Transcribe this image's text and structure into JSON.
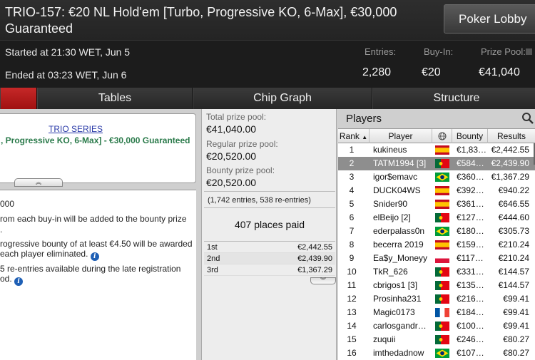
{
  "header": {
    "title": "TRIO-157: €20 NL Hold'em [Turbo, Progressive KO, 6-Max], €30,000 Guaranteed",
    "lobby_button": "Poker Lobby",
    "started": "Started at 21:30 WET, Jun 5",
    "ended": "Ended at 03:23 WET, Jun 6",
    "entries_label": "Entries:",
    "entries_value": "2,280",
    "buyin_label": "Buy-In:",
    "buyin_value": "€20",
    "prizepool_label": "Prize Pool:",
    "prizepool_value": "€41,040"
  },
  "tabs": [
    {
      "label": ""
    },
    {
      "label": "Tables"
    },
    {
      "label": "Chip Graph"
    },
    {
      "label": "Structure"
    }
  ],
  "info": {
    "series_link": "TRIO SERIES",
    "series_name": ", Progressive KO, 6-Max] - €30,000 Guaranteed",
    "collapse_glyph": "︽"
  },
  "description": {
    "line1": "000",
    "line2": "rom each buy-in will be added to the bounty prize",
    "line3": ".",
    "line4": "rogressive bounty of at least €4.50 will be awarded",
    "line5": "each player eliminated.",
    "line6": "5 re-entries available during the late registration",
    "line7": "od."
  },
  "prize": {
    "total_label": "Total prize pool:",
    "total_value": "€41,040.00",
    "regular_label": "Regular prize pool:",
    "regular_value": "€20,520.00",
    "bounty_label": "Bounty prize pool:",
    "bounty_value": "€20,520.00",
    "entries_note": "(1,742 entries, 538 re-entries)",
    "places_paid": "407 places paid",
    "payouts": [
      {
        "place": "1st",
        "amount": "€2,442.55"
      },
      {
        "place": "2nd",
        "amount": "€2,439.90"
      },
      {
        "place": "3rd",
        "amount": "€1,367.29"
      }
    ],
    "expand_glyph": "︾"
  },
  "players": {
    "title": "Players",
    "columns": {
      "rank": "Rank",
      "player": "Player",
      "bounty": "Bounty",
      "results": "Results"
    },
    "rows": [
      {
        "rank": "1",
        "name": "kukineus",
        "flag": "es",
        "bounty": "€1,83…",
        "result": "€2,442.55"
      },
      {
        "rank": "2",
        "name": "TATM1994 [3]",
        "flag": "pt",
        "bounty": "€584…",
        "result": "€2,439.90"
      },
      {
        "rank": "3",
        "name": "igor$emavc",
        "flag": "br",
        "bounty": "€360…",
        "result": "€1,367.29"
      },
      {
        "rank": "4",
        "name": "DUCK04WS",
        "flag": "es",
        "bounty": "€392…",
        "result": "€940.22"
      },
      {
        "rank": "5",
        "name": "Snider90",
        "flag": "es",
        "bounty": "€361…",
        "result": "€646.55"
      },
      {
        "rank": "6",
        "name": "elBeijo [2]",
        "flag": "pt",
        "bounty": "€127…",
        "result": "€444.60"
      },
      {
        "rank": "7",
        "name": "ederpalass0n",
        "flag": "br",
        "bounty": "€180…",
        "result": "€305.73"
      },
      {
        "rank": "8",
        "name": "becerra 2019",
        "flag": "es",
        "bounty": "€159…",
        "result": "€210.24"
      },
      {
        "rank": "9",
        "name": "Ea$y_Moneyy",
        "flag": "pl",
        "bounty": "€117…",
        "result": "€210.24"
      },
      {
        "rank": "10",
        "name": "TkR_626",
        "flag": "pt",
        "bounty": "€331…",
        "result": "€144.57"
      },
      {
        "rank": "11",
        "name": "cbrigos1 [3]",
        "flag": "pt",
        "bounty": "€135…",
        "result": "€144.57"
      },
      {
        "rank": "12",
        "name": "Prosinha231",
        "flag": "pt",
        "bounty": "€216…",
        "result": "€99.41"
      },
      {
        "rank": "13",
        "name": "Magic0173",
        "flag": "fr",
        "bounty": "€184…",
        "result": "€99.41"
      },
      {
        "rank": "14",
        "name": "carlosgandr…",
        "flag": "pt",
        "bounty": "€100…",
        "result": "€99.41"
      },
      {
        "rank": "15",
        "name": "zuquii",
        "flag": "pt",
        "bounty": "€246…",
        "result": "€80.27"
      },
      {
        "rank": "16",
        "name": "imthedadnow",
        "flag": "br",
        "bounty": "€107…",
        "result": "€80.27"
      }
    ]
  },
  "colors": {
    "active_tab": "#c62828",
    "link": "#2a3aa8",
    "series_name": "#2a7a4a",
    "selected_row": "#8e8e8e"
  }
}
